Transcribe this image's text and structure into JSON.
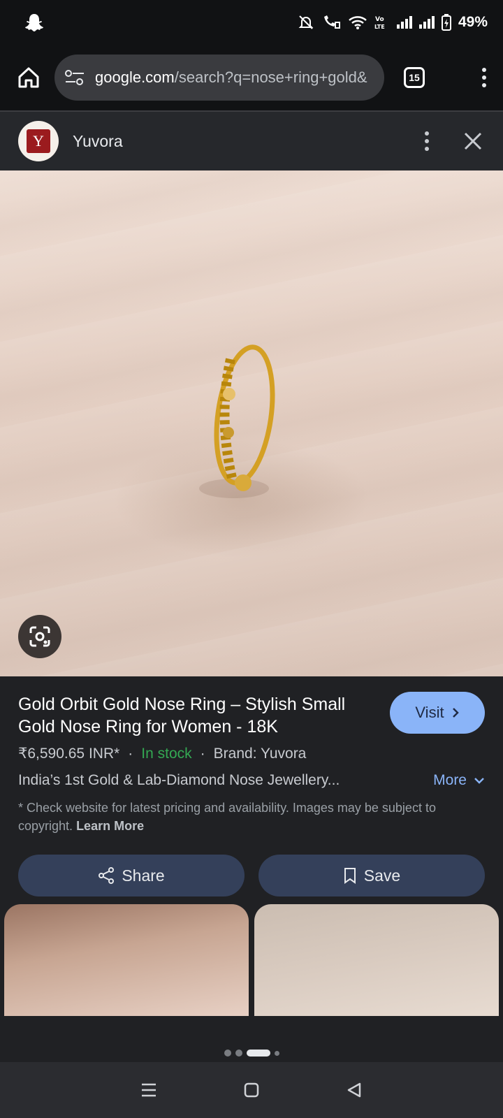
{
  "status_bar": {
    "battery": "49%"
  },
  "browser": {
    "url_host": "google.com",
    "url_path": "/search?q=nose+ring+gold&",
    "tab_count": "15"
  },
  "panel": {
    "site_name": "Yuvora",
    "logo_letter": "Y",
    "product_title": "Gold Orbit Gold Nose Ring – Stylish Small Gold Nose Ring for Women - 18K",
    "visit_label": "Visit",
    "price": "₹6,590.65 INR*",
    "stock": "In stock",
    "brand": "Brand: Yuvora",
    "separator": "·",
    "description": "India’s 1st Gold & Lab-Diamond Nose Jewellery...",
    "more_label": "More",
    "disclaimer": "* Check website for latest pricing and availability. Images may be subject to copyright.",
    "learn_more": "Learn More",
    "share_label": "Share",
    "save_label": "Save"
  },
  "colors": {
    "accent": "#8ab4f8",
    "stock_green": "#34a853",
    "panel_bg": "#202124"
  },
  "icons": [
    "snapchat-icon",
    "mute-icon",
    "wifi-call-icon",
    "wifi-icon",
    "volte-icon",
    "signal-icon",
    "battery-icon",
    "home-icon",
    "site-settings-icon",
    "tabs-icon",
    "menu-icon",
    "close-icon",
    "lens-icon",
    "share-icon",
    "bookmark-icon",
    "chevron-right-icon",
    "chevron-down-icon",
    "recents-icon",
    "home-nav-icon",
    "back-icon"
  ]
}
